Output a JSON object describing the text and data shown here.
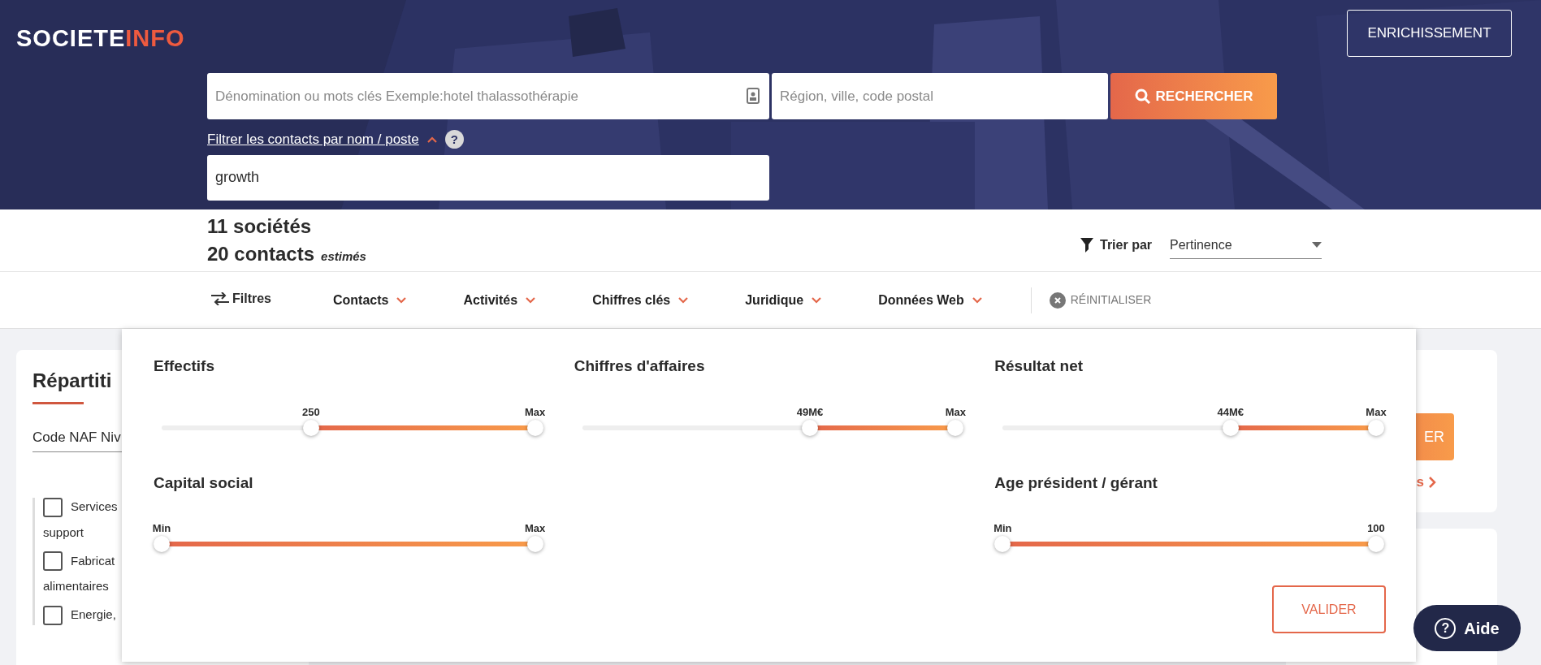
{
  "header": {
    "logo": {
      "main": "SOCIETE",
      "accent": "INFO"
    },
    "enrich_button": "ENRICHISSEMENT",
    "search": {
      "keywords_placeholder": "Dénomination ou mots clés Exemple:hotel thalassothérapie",
      "location_placeholder": "Région, ville, code postal",
      "button": "RECHERCHER"
    },
    "contacts_filter": {
      "link": "Filtrer les contacts par nom / poste",
      "expanded": true,
      "help": "?",
      "value": "growth"
    }
  },
  "results": {
    "companies": "11 sociétés",
    "contacts": "20 contacts",
    "contacts_note": "estimés",
    "sort_label": "Trier par",
    "sort_value": "Pertinence"
  },
  "filter_bar": {
    "filters_label": "Filtres",
    "menus": [
      {
        "label": "Contacts"
      },
      {
        "label": "Activités"
      },
      {
        "label": "Chiffres clés"
      },
      {
        "label": "Juridique"
      },
      {
        "label": "Données Web"
      }
    ],
    "reset": "RÉINITIALISER"
  },
  "filter_panel": {
    "rows": [
      {
        "sliders": [
          {
            "title": "Effectifs",
            "low": {
              "level": 0.4,
              "label": "250"
            },
            "high": {
              "level": 1,
              "label": "Max"
            }
          },
          {
            "title": "Chiffres d'affaires",
            "low": {
              "level": 0.61,
              "label": "49M€"
            },
            "high": {
              "level": 1,
              "label": "Max"
            }
          },
          {
            "title": "Résultat net",
            "low": {
              "level": 0.61,
              "label": "44M€"
            },
            "high": {
              "level": 1,
              "label": "Max"
            }
          }
        ]
      },
      {
        "sliders": [
          {
            "title": "Capital social",
            "low": {
              "level": 0,
              "label": "Min"
            },
            "high": {
              "level": 1,
              "label": "Max"
            }
          },
          {
            "title": "Age président / gérant",
            "low": {
              "level": 0,
              "label": "Min"
            },
            "high": {
              "level": 1,
              "label": "100"
            }
          }
        ]
      }
    ],
    "validate_button": "VALIDER"
  },
  "left_card": {
    "title": "Répartiti",
    "select": "Code NAF Niv",
    "items": [
      {
        "line1": "Services",
        "line2": "support",
        "checked": false
      },
      {
        "line1": "Fabricat",
        "line2": "alimentaires",
        "checked": false
      },
      {
        "line1": "Energie,",
        "checked": false
      }
    ]
  },
  "right_card": {
    "button": "ER",
    "link": "s"
  },
  "help_button": {
    "icon": "?",
    "label": "Aide"
  }
}
